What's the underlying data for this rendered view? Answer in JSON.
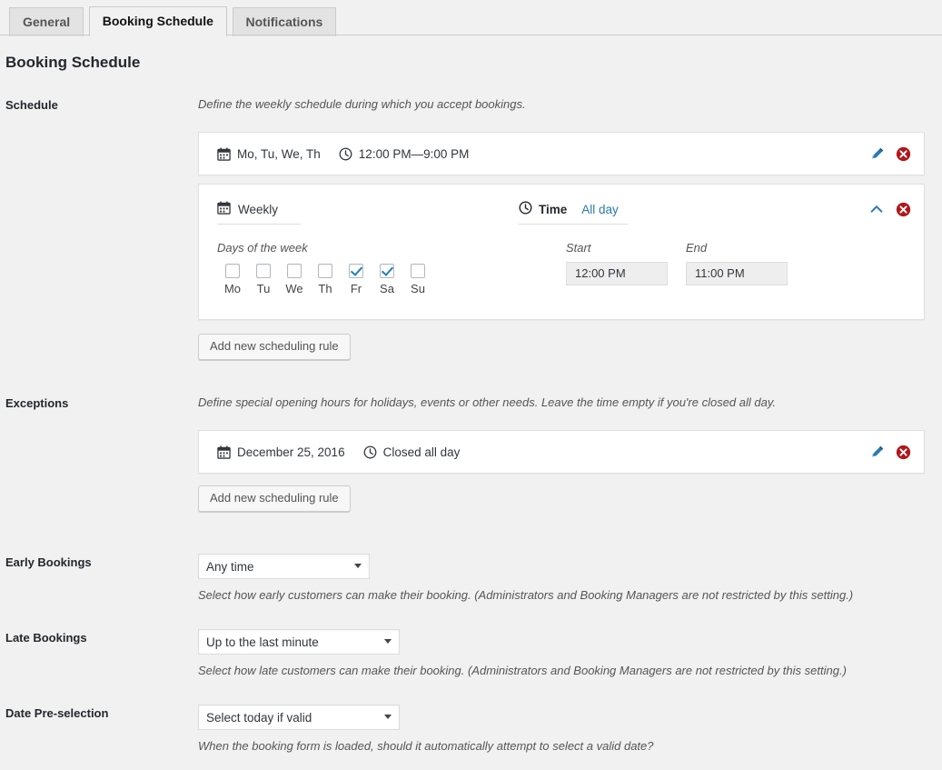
{
  "tabs": [
    {
      "label": "General",
      "active": false
    },
    {
      "label": "Booking Schedule",
      "active": true
    },
    {
      "label": "Notifications",
      "active": false
    }
  ],
  "page_title": "Booking Schedule",
  "colors": {
    "link": "#2a7ab0",
    "checkbox_check": "#1e7fb8",
    "delete_icon": "#b3161a",
    "edit_icon": "#2a7ab0",
    "page_background": "#f1f1f1",
    "panel_background": "#ffffff"
  },
  "schedule": {
    "label": "Schedule",
    "description": "Define the weekly schedule during which you accept bookings.",
    "collapsed_rule": {
      "calendar_icon": "calendar-icon",
      "days_text": "Mo, Tu, We, Th",
      "clock_icon": "clock-icon",
      "time_text": "12:00 PM—9:00 PM",
      "edit_label": "pencil-icon",
      "delete_label": "delete-circle-icon"
    },
    "expanded_rule": {
      "type_icon": "calendar-icon",
      "type_label": "Weekly",
      "time_icon": "clock-icon",
      "time_tab_label": "Time",
      "allday_tab_label": "All day",
      "collapse_icon": "chevron-up-icon",
      "delete_icon": "delete-circle-icon",
      "days_group_label": "Days of the week",
      "days": [
        {
          "name": "Mo",
          "checked": false
        },
        {
          "name": "Tu",
          "checked": false
        },
        {
          "name": "We",
          "checked": false
        },
        {
          "name": "Th",
          "checked": false
        },
        {
          "name": "Fr",
          "checked": true
        },
        {
          "name": "Sa",
          "checked": true
        },
        {
          "name": "Su",
          "checked": false
        }
      ],
      "start_label": "Start",
      "start_value": "12:00 PM",
      "end_label": "End",
      "end_value": "11:00 PM"
    },
    "add_button_label": "Add new scheduling rule"
  },
  "exceptions": {
    "label": "Exceptions",
    "description": "Define special opening hours for holidays, events or other needs. Leave the time empty if you're closed all day.",
    "rule": {
      "calendar_icon": "calendar-icon",
      "date_text": "December 25, 2016",
      "clock_icon": "clock-icon",
      "time_text": "Closed all day"
    },
    "add_button_label": "Add new scheduling rule"
  },
  "early_bookings": {
    "label": "Early Bookings",
    "value": "Any time",
    "options": [
      "Any time"
    ],
    "description": "Select how early customers can make their booking. (Administrators and Booking Managers are not restricted by this setting.)"
  },
  "late_bookings": {
    "label": "Late Bookings",
    "value": "Up to the last minute",
    "options": [
      "Up to the last minute"
    ],
    "description": "Select how late customers can make their booking. (Administrators and Booking Managers are not restricted by this setting.)"
  },
  "date_preselection": {
    "label": "Date Pre-selection",
    "value": "Select today if valid",
    "options": [
      "Select today if valid"
    ],
    "description": "When the booking form is loaded, should it automatically attempt to select a valid date?"
  }
}
